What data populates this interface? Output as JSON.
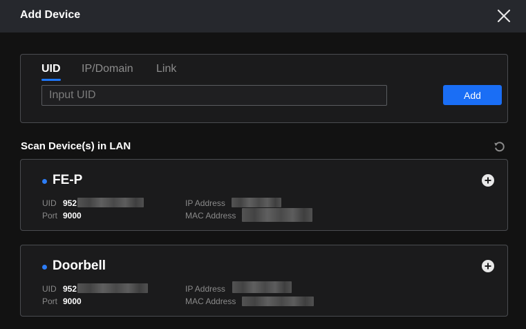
{
  "dialog": {
    "title": "Add Device",
    "close_icon": "close-icon"
  },
  "tabs": [
    {
      "label": "UID",
      "active": true
    },
    {
      "label": "IP/Domain",
      "active": false
    },
    {
      "label": "Link",
      "active": false
    }
  ],
  "uid_input": {
    "placeholder": "Input UID",
    "value": ""
  },
  "add_button": {
    "label": "Add"
  },
  "scan": {
    "title": "Scan Device(s) in LAN",
    "refresh_icon": "refresh-icon"
  },
  "devices": [
    {
      "name": "FE-P",
      "uid_label": "UID",
      "uid_value": "952",
      "port_label": "Port",
      "port_value": "9000",
      "ip_label": "IP Address",
      "mac_label": "MAC Address"
    },
    {
      "name": "Doorbell",
      "uid_label": "UID",
      "uid_value": "952",
      "port_label": "Port",
      "port_value": "9000",
      "ip_label": "IP Address",
      "mac_label": "MAC Address"
    }
  ],
  "colors": {
    "accent": "#1a6ef5",
    "status_dot": "#2d7df6",
    "background": "#121212",
    "titlebar": "#26282d"
  }
}
